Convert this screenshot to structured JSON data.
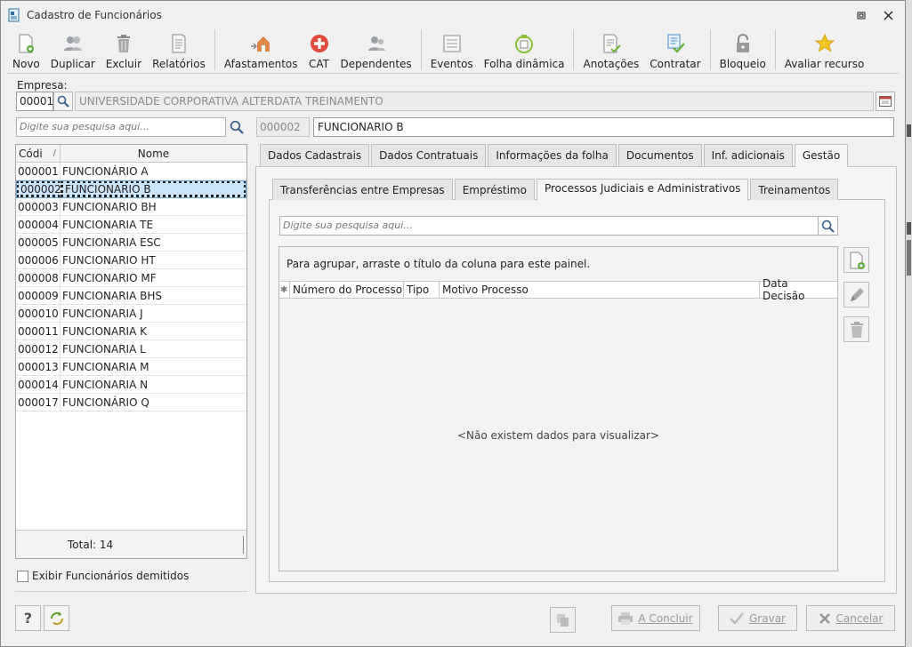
{
  "window": {
    "title": "Cadastro de Funcionários"
  },
  "toolbar": {
    "buttons": [
      {
        "label": "Novo",
        "icon": "new-document-icon"
      },
      {
        "label": "Duplicar",
        "icon": "users-icon"
      },
      {
        "label": "Excluir",
        "icon": "trash-icon"
      },
      {
        "label": "Relatórios",
        "icon": "report-icon"
      },
      {
        "label": "Afastamentos",
        "icon": "house-arrow-icon"
      },
      {
        "label": "CAT",
        "icon": "medical-cross-icon"
      },
      {
        "label": "Dependentes",
        "icon": "users-icon"
      },
      {
        "label": "Eventos",
        "icon": "list-icon"
      },
      {
        "label": "Folha dinâmica",
        "icon": "calendar-refresh-icon"
      },
      {
        "label": "Anotações",
        "icon": "notes-check-icon"
      },
      {
        "label": "Contratar",
        "icon": "contract-check-icon"
      },
      {
        "label": "Bloqueio",
        "icon": "lock-icon"
      },
      {
        "label": "Avaliar recurso",
        "icon": "star-icon"
      }
    ]
  },
  "empresa": {
    "label": "Empresa:",
    "code": "00001",
    "name": "UNIVERSIDADE CORPORATIVA ALTERDATA TREINAMENTO"
  },
  "left": {
    "search_placeholder": "Digite sua pesquisa aqui...",
    "columns": {
      "code": "Códi",
      "sort": "/",
      "name": "Nome"
    },
    "rows": [
      {
        "code": "000001",
        "name": "FUNCIONÁRIO A"
      },
      {
        "code": "000002",
        "name": "FUNCIONARIO B"
      },
      {
        "code": "000003",
        "name": "FUNCIONARIO BH"
      },
      {
        "code": "000004",
        "name": "FUNCIONARIA TE"
      },
      {
        "code": "000005",
        "name": "FUNCIONARIA ESC"
      },
      {
        "code": "000006",
        "name": "FUNCIONARIO HT"
      },
      {
        "code": "000008",
        "name": "FUNCIONARIO MF"
      },
      {
        "code": "000009",
        "name": "FUNCIONARIA BHS"
      },
      {
        "code": "000010",
        "name": "FUNCIONARIA J"
      },
      {
        "code": "000011",
        "name": "FUNCIONARIA K"
      },
      {
        "code": "000012",
        "name": "FUNCIONARIA L"
      },
      {
        "code": "000013",
        "name": "FUNCIONARIA M"
      },
      {
        "code": "000014",
        "name": "FUNCIONARIA N"
      },
      {
        "code": "000017",
        "name": "FUNCIONÁRIO Q"
      }
    ],
    "selected_index": 1,
    "total": "Total: 14",
    "show_dismissed": "Exibir Funcionários demitidos"
  },
  "employee": {
    "code": "000002",
    "name": "FUNCIONARIO B"
  },
  "tabs": [
    {
      "label": "Dados Cadastrais",
      "active": false
    },
    {
      "label": "Dados Contratuais",
      "active": false
    },
    {
      "label": "Informações da folha",
      "active": false
    },
    {
      "label": "Documentos",
      "active": false
    },
    {
      "label": "Inf. adicionais",
      "active": false
    },
    {
      "label": "Gestão",
      "active": true
    }
  ],
  "subtabs": [
    {
      "label": "Transferências entre Empresas",
      "active": false
    },
    {
      "label": "Empréstimo",
      "active": false
    },
    {
      "label": "Processos Judiciais e Administrativos",
      "active": true
    },
    {
      "label": "Treinamentos",
      "active": false
    }
  ],
  "processos": {
    "search_placeholder": "Digite sua pesquisa aqui...",
    "group_hint": "Para agrupar, arraste o título da coluna para este painel.",
    "columns": [
      "Número do Processo",
      "Tipo",
      "Motivo Processo",
      "Data Decisão"
    ],
    "empty": "<Não existem dados para visualizar>"
  },
  "footer": {
    "concluir": "A Concluir",
    "gravar": "Gravar",
    "cancelar": "Cancelar"
  }
}
